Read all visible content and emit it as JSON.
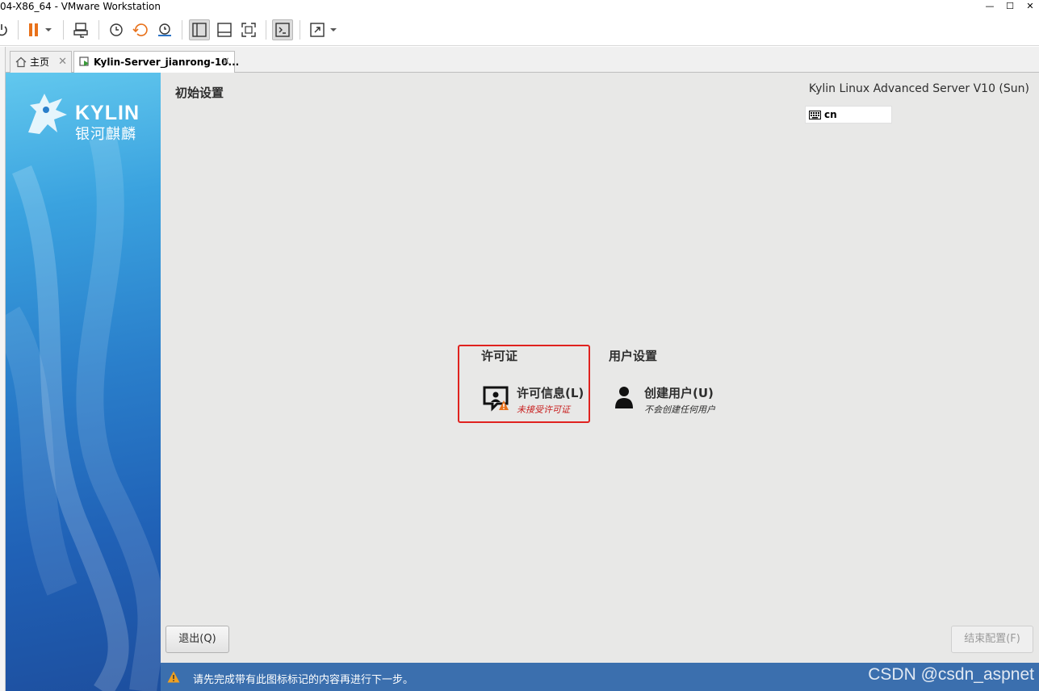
{
  "window": {
    "title": "04-X86_64 - VMware Workstation",
    "controls": [
      "—",
      "☐",
      "✕"
    ]
  },
  "toolbar": {
    "icons": [
      "power-icon",
      "pause-icon",
      "dropdown-arrow-icon",
      "send-ctrl-alt-del-icon",
      "snapshot-icon",
      "revert-snapshot-icon",
      "snapshot-manager-icon",
      "library-view-icon",
      "thumbnail-view-icon",
      "fullscreen-icon",
      "console-view-icon",
      "stretch-icon",
      "dropdown-arrow-icon"
    ],
    "accent": "#e8711a"
  },
  "tabs": [
    {
      "label": "主页",
      "close": "✕",
      "icon": "home-icon"
    },
    {
      "label": "Kylin-Server_jianrong-10...",
      "close": "✕",
      "icon": "vm-running-icon"
    }
  ],
  "sidebar": {
    "logo_text": "KYLIN",
    "logo_sub": "银河麒麟"
  },
  "header": {
    "page_title": "初始设置",
    "product": "Kylin Linux Advanced Server V10 (Sun)",
    "keyboard_layout": "cn"
  },
  "sections": [
    {
      "title": "许可证",
      "spoke": {
        "name": "许可信息(L)",
        "status": "未接受许可证",
        "status_color": "#c81e1e",
        "icon": "license-warning-icon"
      }
    },
    {
      "title": "用户设置",
      "spoke": {
        "name": "创建用户(U)",
        "status": "不会创建任何用户",
        "status_color": "#2e2e2e",
        "icon": "user-icon"
      }
    }
  ],
  "buttons": {
    "quit": "退出(Q)",
    "finish": "结束配置(F)"
  },
  "infobar": {
    "message": "请先完成带有此图标标记的内容再进行下一步。",
    "color": "#3b6fae"
  },
  "watermark": "CSDN @csdn_aspnet"
}
